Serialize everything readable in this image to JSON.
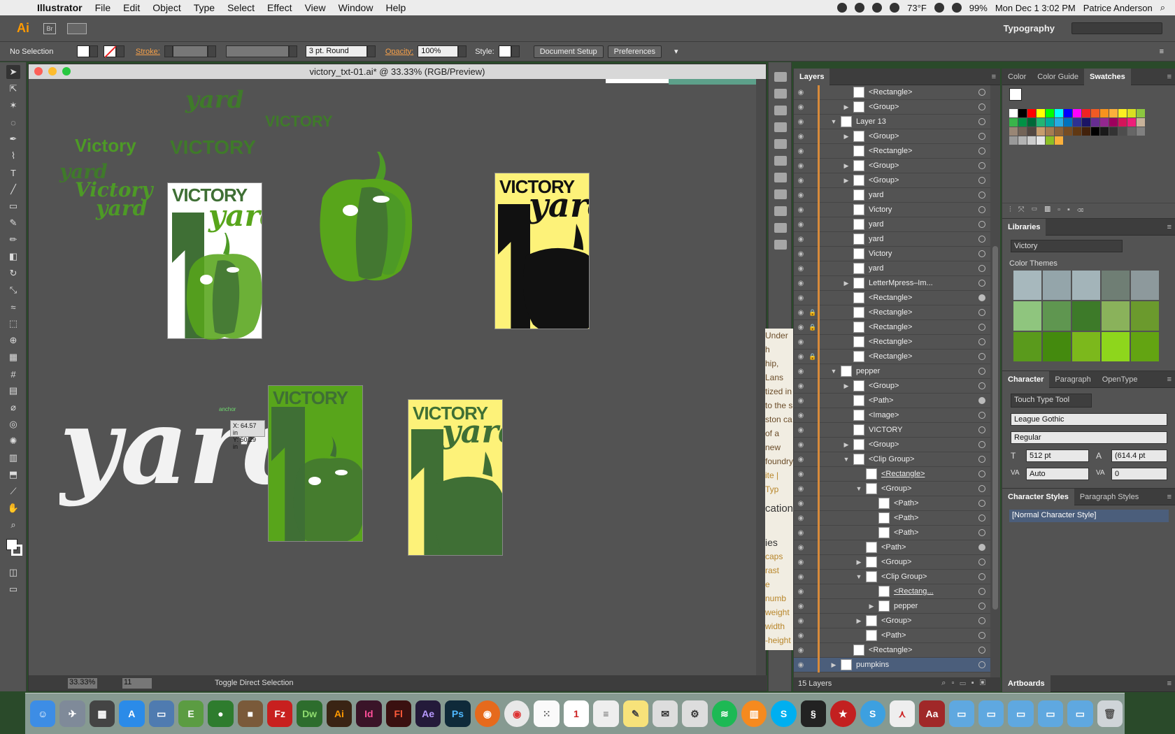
{
  "menubar": {
    "app": "Illustrator",
    "menus": [
      "File",
      "Edit",
      "Object",
      "Type",
      "Select",
      "Effect",
      "View",
      "Window",
      "Help"
    ],
    "weather": "73°F",
    "battery": "99%",
    "datetime": "Mon Dec 1  3:02 PM",
    "user": "Patrice Anderson"
  },
  "appbar": {
    "logo": "Ai",
    "bridge": "Br",
    "workspace": "Typography"
  },
  "control": {
    "selection": "No Selection",
    "stroke_label": "Stroke:",
    "brush": "3 pt. Round",
    "opacity_label": "Opacity:",
    "opacity_value": "100%",
    "style_label": "Style:",
    "document_setup": "Document Setup",
    "preferences": "Preferences"
  },
  "document": {
    "title": "victory_txt-01.ai* @ 33.33% (RGB/Preview)",
    "zoom": "33.33%",
    "page": "11",
    "status": "Toggle Direct Selection",
    "cursor_label": "anchor",
    "cursor_x": "X: 64.57 in",
    "cursor_y": "Y: 50.29 in"
  },
  "artwork": {
    "loose_yard_1": "yard",
    "loose_victory_1": "VICTORY",
    "loose_victory_2": "Victory",
    "loose_victory_3": "VICTORY",
    "loose_yard_2": "yard",
    "loose_victory_4": "Victory",
    "loose_yard_3": "yard",
    "card_victory": "VICTORY",
    "card_yard": "yard",
    "big_yard": "yard"
  },
  "peek_text": [
    "Under h",
    "hip, Lans",
    "tized in",
    "to the s",
    "ston ca",
    "of a new",
    "foundry",
    "ite | Typ",
    "",
    "cation",
    "",
    "ies",
    "caps",
    "rast",
    "e numb",
    "weight",
    "width",
    "-height"
  ],
  "layers": {
    "tab": "Layers",
    "count": "15 Layers",
    "rows": [
      {
        "name": "<Rectangle>",
        "indent": 1,
        "arrow": "",
        "circle": "",
        "lock": ""
      },
      {
        "name": "<Group>",
        "indent": 1,
        "arrow": "▶",
        "circle": "",
        "lock": ""
      },
      {
        "name": "Layer 13",
        "indent": 0,
        "arrow": "▼",
        "circle": "",
        "lock": ""
      },
      {
        "name": "<Group>",
        "indent": 1,
        "arrow": "▶",
        "circle": "",
        "lock": ""
      },
      {
        "name": "<Rectangle>",
        "indent": 1,
        "arrow": "",
        "circle": "",
        "lock": ""
      },
      {
        "name": "<Group>",
        "indent": 1,
        "arrow": "▶",
        "circle": "",
        "lock": ""
      },
      {
        "name": "<Group>",
        "indent": 1,
        "arrow": "▶",
        "circle": "",
        "lock": ""
      },
      {
        "name": "yard",
        "indent": 1,
        "arrow": "",
        "circle": "",
        "lock": ""
      },
      {
        "name": "Victory",
        "indent": 1,
        "arrow": "",
        "circle": "",
        "lock": ""
      },
      {
        "name": "yard",
        "indent": 1,
        "arrow": "",
        "circle": "",
        "lock": ""
      },
      {
        "name": "yard",
        "indent": 1,
        "arrow": "",
        "circle": "",
        "lock": ""
      },
      {
        "name": "Victory",
        "indent": 1,
        "arrow": "",
        "circle": "",
        "lock": ""
      },
      {
        "name": "yard",
        "indent": 1,
        "arrow": "",
        "circle": "",
        "lock": ""
      },
      {
        "name": "LetterMpress–Im...",
        "indent": 1,
        "arrow": "▶",
        "circle": "",
        "lock": ""
      },
      {
        "name": "<Rectangle>",
        "indent": 1,
        "arrow": "",
        "circle": "filled",
        "lock": ""
      },
      {
        "name": "<Rectangle>",
        "indent": 1,
        "arrow": "",
        "circle": "",
        "lock": "🔒"
      },
      {
        "name": "<Rectangle>",
        "indent": 1,
        "arrow": "",
        "circle": "",
        "lock": "🔒"
      },
      {
        "name": "<Rectangle>",
        "indent": 1,
        "arrow": "",
        "circle": "",
        "lock": ""
      },
      {
        "name": "<Rectangle>",
        "indent": 1,
        "arrow": "",
        "circle": "",
        "lock": "🔒"
      },
      {
        "name": "pepper",
        "indent": 0,
        "arrow": "▼",
        "circle": "",
        "lock": ""
      },
      {
        "name": "<Group>",
        "indent": 1,
        "arrow": "▶",
        "circle": "",
        "lock": ""
      },
      {
        "name": "<Path>",
        "indent": 1,
        "arrow": "",
        "circle": "filled",
        "lock": ""
      },
      {
        "name": "<Image>",
        "indent": 1,
        "arrow": "",
        "circle": "",
        "lock": ""
      },
      {
        "name": "VICTORY",
        "indent": 1,
        "arrow": "",
        "circle": "",
        "lock": ""
      },
      {
        "name": "<Group>",
        "indent": 1,
        "arrow": "▶",
        "circle": "",
        "lock": ""
      },
      {
        "name": "<Clip Group>",
        "indent": 1,
        "arrow": "▼",
        "circle": "",
        "lock": ""
      },
      {
        "name": "<Rectangle>",
        "indent": 2,
        "arrow": "",
        "circle": "",
        "lock": "",
        "u": true
      },
      {
        "name": "<Group>",
        "indent": 2,
        "arrow": "▼",
        "circle": "",
        "lock": ""
      },
      {
        "name": "<Path>",
        "indent": 3,
        "arrow": "",
        "circle": "",
        "lock": ""
      },
      {
        "name": "<Path>",
        "indent": 3,
        "arrow": "",
        "circle": "",
        "lock": ""
      },
      {
        "name": "<Path>",
        "indent": 3,
        "arrow": "",
        "circle": "",
        "lock": ""
      },
      {
        "name": "<Path>",
        "indent": 2,
        "arrow": "",
        "circle": "filled",
        "lock": ""
      },
      {
        "name": "<Group>",
        "indent": 2,
        "arrow": "▶",
        "circle": "",
        "lock": ""
      },
      {
        "name": "<Clip Group>",
        "indent": 2,
        "arrow": "▼",
        "circle": "",
        "lock": ""
      },
      {
        "name": "<Rectang...",
        "indent": 3,
        "arrow": "",
        "circle": "",
        "lock": "",
        "u": true
      },
      {
        "name": "pepper",
        "indent": 3,
        "arrow": "▶",
        "circle": "",
        "lock": ""
      },
      {
        "name": "<Group>",
        "indent": 2,
        "arrow": "▶",
        "circle": "",
        "lock": ""
      },
      {
        "name": "<Path>",
        "indent": 2,
        "arrow": "",
        "circle": "",
        "lock": ""
      },
      {
        "name": "<Rectangle>",
        "indent": 1,
        "arrow": "",
        "circle": "",
        "lock": ""
      },
      {
        "name": "pumpkins",
        "indent": 0,
        "arrow": "▶",
        "circle": "",
        "lock": "",
        "sel": true
      }
    ]
  },
  "swatches_panel": {
    "tabs": [
      "Color",
      "Color Guide",
      "Swatches"
    ],
    "active": "Swatches",
    "colors": [
      "#ffffff",
      "#000000",
      "#ff0000",
      "#ffff00",
      "#00ff00",
      "#00ffff",
      "#0000ff",
      "#ff00ff",
      "#ee2222",
      "#f15a24",
      "#f7931e",
      "#fbb03b",
      "#fcee21",
      "#d9e021",
      "#8cc63f",
      "#39b54a",
      "#009245",
      "#006837",
      "#22b573",
      "#00a99d",
      "#29abe2",
      "#0071bc",
      "#2e3192",
      "#1b1464",
      "#662d91",
      "#93278f",
      "#9e005d",
      "#d4145a",
      "#ed1e79",
      "#c7b299",
      "#998675",
      "#736357",
      "#534741",
      "#c69c6d",
      "#a67c52",
      "#8c6239",
      "#754c24",
      "#603813",
      "#42210b",
      "#000000",
      "#1a1a1a",
      "#333333",
      "#4d4d4d",
      "#666666",
      "#808080",
      "#999999",
      "#b3b3b3",
      "#cccccc",
      "#e6e6e6",
      "#8cbf26",
      "#fbb03b"
    ]
  },
  "libraries": {
    "title": "Libraries",
    "selected": "Victory",
    "themes_label": "Color Themes",
    "themes": [
      [
        "#a7b8bd",
        "#94a5aa",
        "#a3b4b9",
        "#6f7e74",
        "#8d999c"
      ],
      [
        "#8fc57e",
        "#5f9650",
        "#3d7a29",
        "#8ab25b",
        "#6b9a2d"
      ],
      [
        "#5a9a1c",
        "#448a0e",
        "#7cb81c",
        "#8ed61c",
        "#63a412"
      ]
    ]
  },
  "character": {
    "tabs": [
      "Character",
      "Paragraph",
      "OpenType"
    ],
    "touch_tool": "Touch Type Tool",
    "font": "League Gothic",
    "style": "Regular",
    "size": "512 pt",
    "leading": "(614.4 pt",
    "kerning": "Auto",
    "tracking": "0"
  },
  "char_styles": {
    "tabs": [
      "Character Styles",
      "Paragraph Styles"
    ],
    "item": "[Normal Character Style]"
  },
  "artboards": {
    "title": "Artboards"
  },
  "dock": {
    "apps": [
      "Ps",
      "Ai",
      "Id",
      "Fl",
      "Ae",
      "Dw",
      "Fz"
    ]
  },
  "colors": {
    "green_dark": "#3f6f35",
    "green_mid": "#58a51b",
    "green_light": "#6fb52a",
    "yellow": "#fdf279",
    "canvas": "#535353"
  }
}
